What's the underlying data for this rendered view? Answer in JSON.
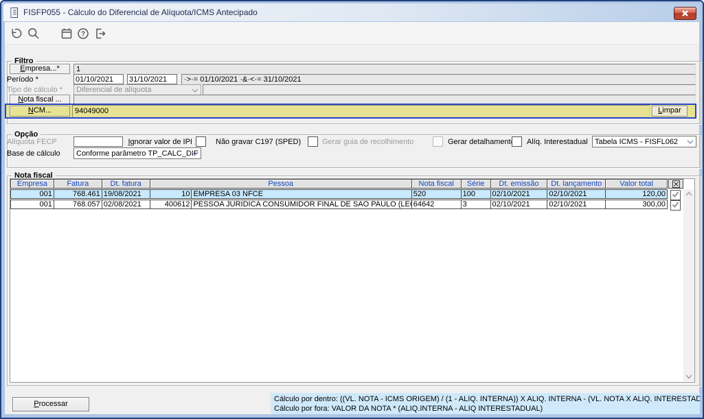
{
  "window": {
    "title": "FISFP055 - Cálculo do Diferencial de Alíquota/ICMS Antecipado"
  },
  "toolbar": {
    "icons": [
      "undo",
      "search",
      "calendar",
      "help",
      "exit"
    ]
  },
  "filtro": {
    "legend": "Filtro",
    "empresa_button": "Empresa...*",
    "empresa_value": "1",
    "periodo_label": "Período *",
    "periodo_from": "01/10/2021",
    "periodo_to": "31/10/2021",
    "periodo_display": "·>·= 01/10/2021  ·&·<·= 31/10/2021",
    "tipo_calculo_label": "Tipo de cálculo *",
    "tipo_calculo_value": "Diferencial de alíquota",
    "nota_fiscal_button": "Nota fiscal ...",
    "nota_fiscal_value": "",
    "ncm_button": "NCM...",
    "ncm_value": "94049000",
    "limpar_button": "Limpar"
  },
  "opcao": {
    "legend": "Opção",
    "aliquota_fecp_label": "Alíquota FECP",
    "aliquota_fecp_value": "",
    "ignorar_ipi_label": "Ignorar valor de IPI",
    "ignorar_ipi_checked": false,
    "nao_gravar_c197_label": "Não gravar C197 (SPED)",
    "nao_gravar_c197_checked": false,
    "gerar_guia_label": "Gerar guia de recolhimento",
    "gerar_guia_checked": false,
    "gerar_detalhamento_label": "Gerar detalhamento",
    "gerar_detalhamento_checked": false,
    "aliq_interestadual_label": "Alíq. Interestadual",
    "aliq_interestadual_value": "Tabela ICMS - FISFL062",
    "base_calculo_label": "Base de cálculo",
    "base_calculo_value": "Conforme parâmetro TP_CALC_DIF"
  },
  "nota_fiscal": {
    "legend": "Nota fiscal",
    "columns": {
      "empresa": "Empresa",
      "fatura": "Fatura",
      "dt_fatura": "Dt. fatura",
      "pessoa": "Pessoa",
      "nota_fiscal": "Nota fiscal",
      "serie": "Série",
      "dt_emissao": "Dt. emissão",
      "dt_lancamento": "Dt. lançamento",
      "valor_total": "Valor total"
    },
    "rows": [
      {
        "empresa": "001",
        "fatura": "768.461",
        "dt_fatura": "19/08/2021",
        "pessoa_codigo": "10",
        "pessoa_nome": "EMPRESA 03 NFCE",
        "nota_fiscal": "520",
        "serie": "100",
        "dt_emissao": "02/10/2021",
        "dt_lancamento": "02/10/2021",
        "valor_total": "120,00",
        "selected": true,
        "checked": true
      },
      {
        "empresa": "001",
        "fatura": "768.057",
        "dt_fatura": "02/08/2021",
        "pessoa_codigo": "400612",
        "pessoa_nome": "PESSOA JURIDICA CONSUMIDOR FINAL DE SAO PAULO (LEONA",
        "nota_fiscal": "64642",
        "serie": "3",
        "dt_emissao": "02/10/2021",
        "dt_lancamento": "02/10/2021",
        "valor_total": "300,00",
        "selected": false,
        "checked": true
      }
    ]
  },
  "footer": {
    "processar_button": "Processar",
    "formula_line1": "Cálculo por dentro: ((VL. NOTA - ICMS ORIGEM) / (1 - ALIQ. INTERNA)) X ALIQ. INTERNA - (VL. NOTA X ALIQ. INTERESTADUAL)",
    "formula_line2": "Cálculo por fora: VALOR DA NOTA * (ALIQ.INTERNA - ALIQ INTERESTADUAL)"
  },
  "colors": {
    "ncm_highlight": "#e7e392",
    "focus_border": "#2946c8",
    "selected_row": "#c8e9fe",
    "grid_header_text": "#1748c4",
    "formula_background": "#cfe9fb",
    "close_button_red": "#b23b27",
    "titlebar_gradient_end": "#b7cde9"
  }
}
